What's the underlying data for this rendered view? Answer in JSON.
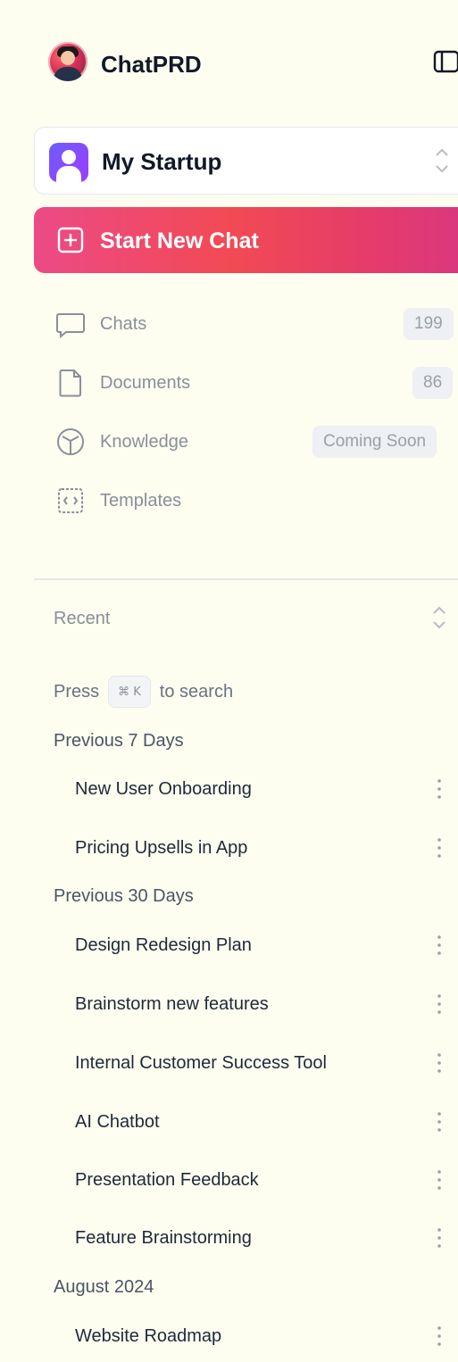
{
  "header": {
    "app_title": "ChatPRD"
  },
  "workspace": {
    "name": "My Startup"
  },
  "actions": {
    "start_new_chat": "Start New Chat"
  },
  "nav": {
    "items": [
      {
        "label": "Chats",
        "badge": "199",
        "icon": "chat-bubble-icon"
      },
      {
        "label": "Documents",
        "badge": "86",
        "icon": "document-icon"
      },
      {
        "label": "Knowledge",
        "badge": "Coming Soon",
        "icon": "cube-icon"
      },
      {
        "label": "Templates",
        "badge": "",
        "icon": "template-icon"
      }
    ]
  },
  "recent": {
    "label": "Recent",
    "search_hint": {
      "prefix": "Press",
      "shortcut": "⌘ K",
      "suffix": "to search"
    },
    "groups": [
      {
        "title": "Previous 7 Days",
        "items": [
          "New User Onboarding",
          "Pricing Upsells in App"
        ]
      },
      {
        "title": "Previous 30 Days",
        "items": [
          "Design Redesign Plan",
          "Brainstorm new features",
          "Internal Customer Success Tool",
          "AI Chatbot",
          "Presentation Feedback",
          "Feature Brainstorming"
        ]
      },
      {
        "title": "August 2024",
        "items": [
          "Website Roadmap"
        ]
      }
    ]
  },
  "colors": {
    "background": "#fdfdf0",
    "accent_start": "#ec4a86",
    "accent_mid": "#f24a54",
    "accent_end": "#d93780",
    "workspace_icon": "#6d5cff"
  }
}
